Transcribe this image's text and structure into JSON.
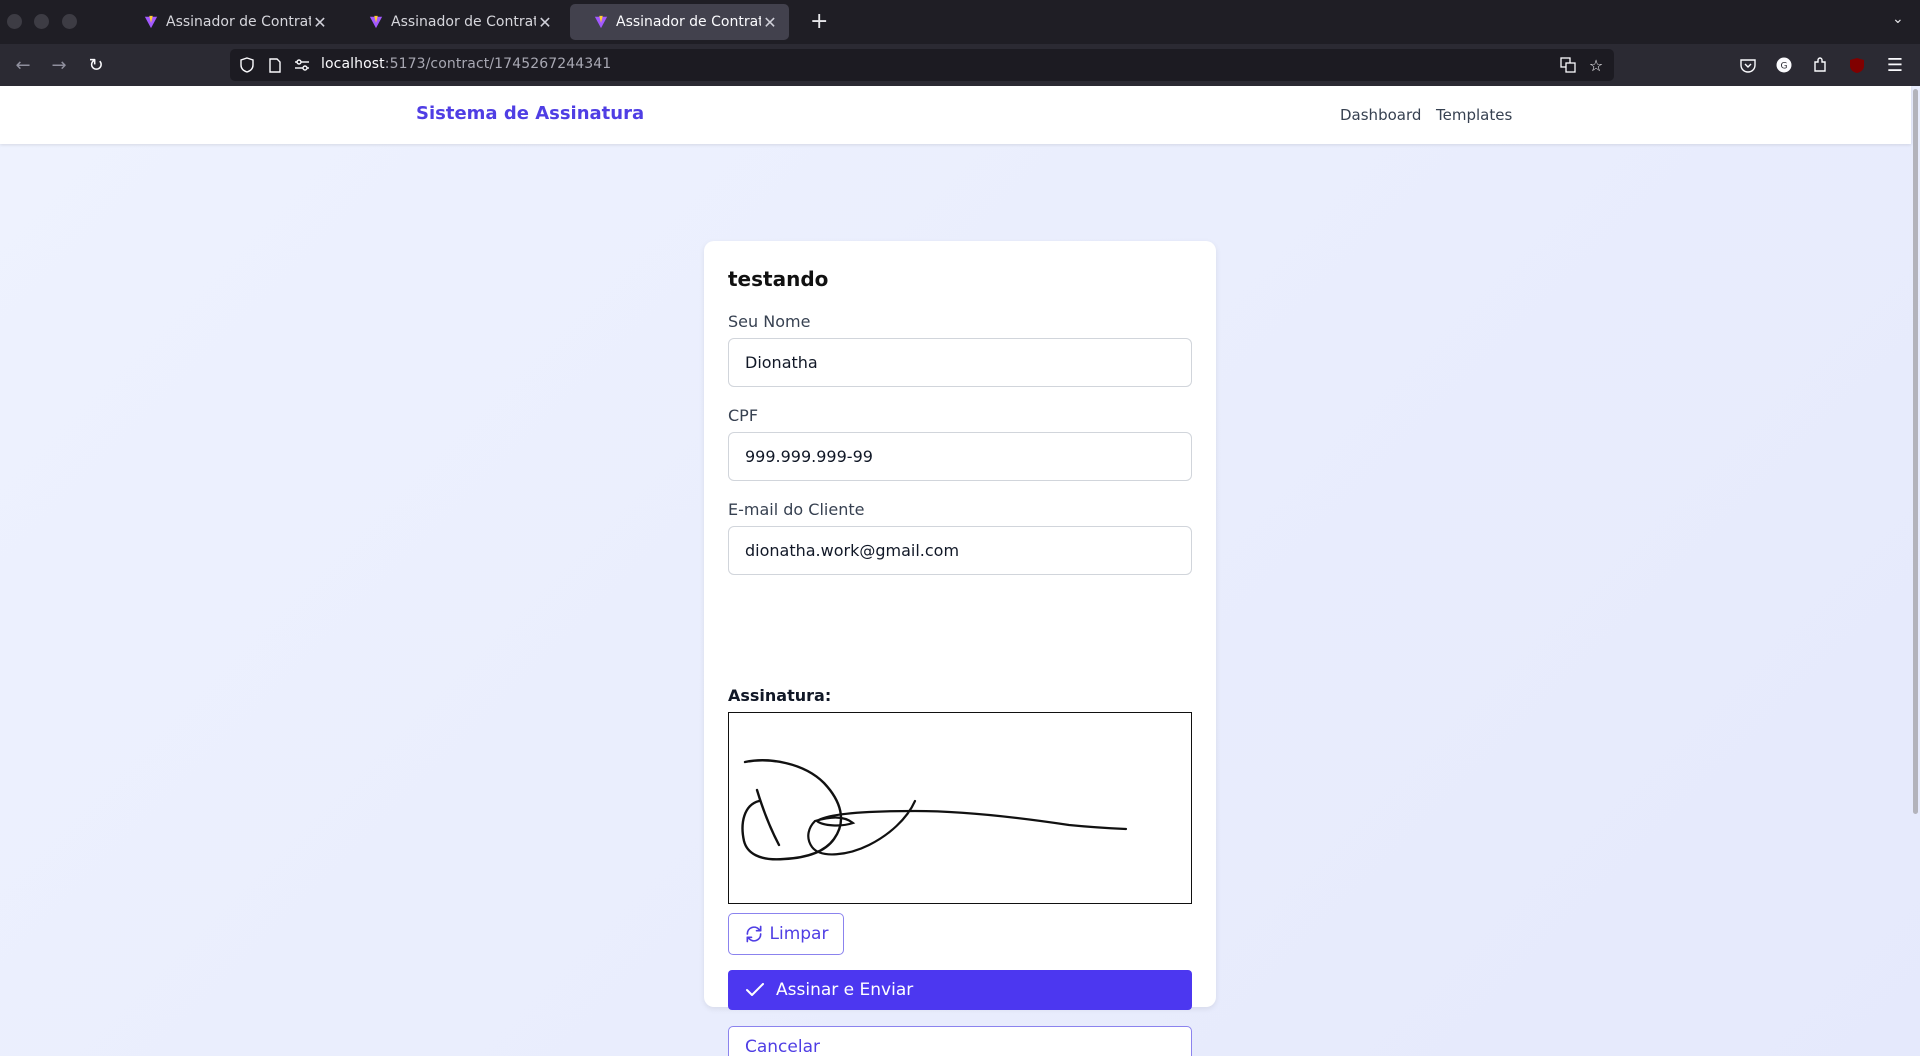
{
  "browser": {
    "tabs": [
      {
        "title": "Assinador de Contratos",
        "active": false
      },
      {
        "title": "Assinador de Contratos",
        "active": false
      },
      {
        "title": "Assinador de Contratos",
        "active": true
      }
    ],
    "url_host": "localhost",
    "url_rest": ":5173/contract/1745267244341"
  },
  "header": {
    "brand": "Sistema de Assinatura",
    "nav": [
      "Dashboard",
      "Templates"
    ]
  },
  "form": {
    "title": "testando",
    "name_label": "Seu Nome",
    "name_value": "Dionatha",
    "cpf_label": "CPF",
    "cpf_value": "999.999.999-99",
    "email_label": "E-mail do Cliente",
    "email_value": "dionatha.work@gmail.com",
    "signature_label": "Assinatura:",
    "clear_label": "Limpar",
    "submit_label": "Assinar e Enviar",
    "cancel_label": "Cancelar"
  },
  "colors": {
    "brand": "#4f3ee4",
    "primary_button": "#4c37f0",
    "page_background": "#eaeefd"
  },
  "icons": [
    "back-icon",
    "forward-icon",
    "reload-icon",
    "shield-icon",
    "page-icon",
    "permissions-icon",
    "translate-icon",
    "star-icon",
    "pocket-icon",
    "account-icon",
    "extensions-icon",
    "ublock-icon",
    "menu-icon",
    "refresh-icon",
    "check-icon"
  ]
}
